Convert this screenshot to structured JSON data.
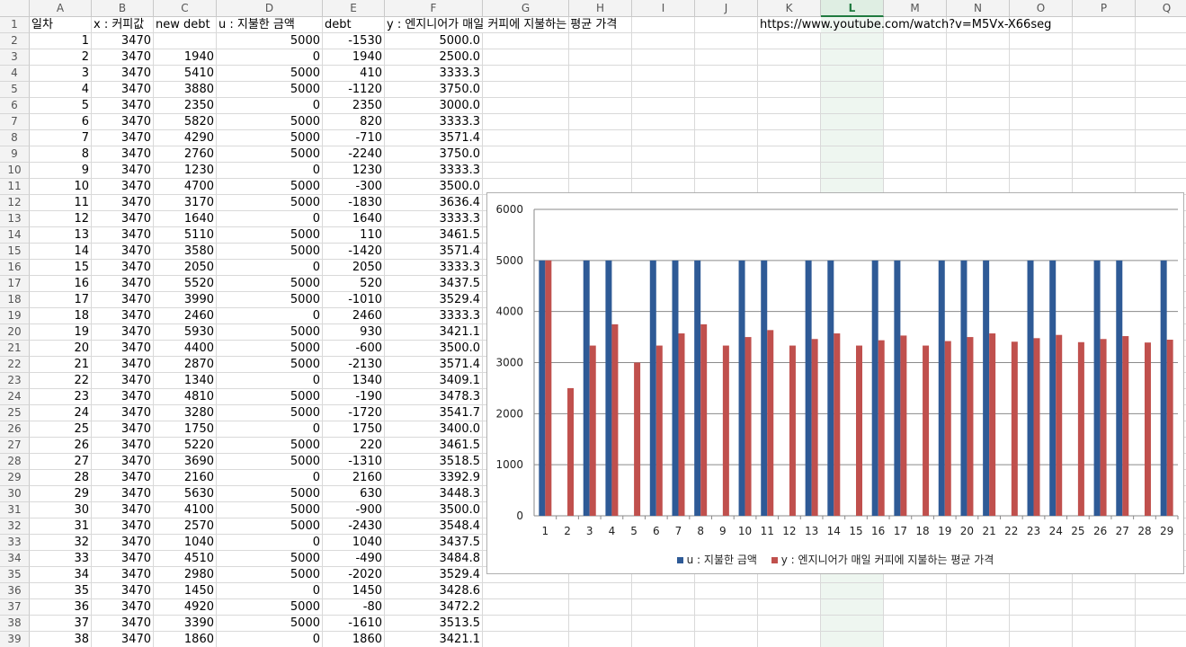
{
  "columns": [
    "A",
    "B",
    "C",
    "D",
    "E",
    "F",
    "G",
    "H",
    "I",
    "J",
    "K",
    "L",
    "M",
    "N",
    "O",
    "P",
    "Q"
  ],
  "selected_column": "L",
  "header_row": {
    "A": "일차",
    "B": "x : 커피값",
    "C": "new debt",
    "D": "u : 지불한 금액",
    "E": "debt",
    "F": "y : 엔지니어가 매일 커피에 지불하는 평균 가격",
    "K": "https://www.youtube.com/watch?v=M5Vx-X66seg"
  },
  "rows": [
    [
      "1",
      "3470",
      "",
      "5000",
      "-1530",
      "5000.0"
    ],
    [
      "2",
      "3470",
      "1940",
      "0",
      "1940",
      "2500.0"
    ],
    [
      "3",
      "3470",
      "5410",
      "5000",
      "410",
      "3333.3"
    ],
    [
      "4",
      "3470",
      "3880",
      "5000",
      "-1120",
      "3750.0"
    ],
    [
      "5",
      "3470",
      "2350",
      "0",
      "2350",
      "3000.0"
    ],
    [
      "6",
      "3470",
      "5820",
      "5000",
      "820",
      "3333.3"
    ],
    [
      "7",
      "3470",
      "4290",
      "5000",
      "-710",
      "3571.4"
    ],
    [
      "8",
      "3470",
      "2760",
      "5000",
      "-2240",
      "3750.0"
    ],
    [
      "9",
      "3470",
      "1230",
      "0",
      "1230",
      "3333.3"
    ],
    [
      "10",
      "3470",
      "4700",
      "5000",
      "-300",
      "3500.0"
    ],
    [
      "11",
      "3470",
      "3170",
      "5000",
      "-1830",
      "3636.4"
    ],
    [
      "12",
      "3470",
      "1640",
      "0",
      "1640",
      "3333.3"
    ],
    [
      "13",
      "3470",
      "5110",
      "5000",
      "110",
      "3461.5"
    ],
    [
      "14",
      "3470",
      "3580",
      "5000",
      "-1420",
      "3571.4"
    ],
    [
      "15",
      "3470",
      "2050",
      "0",
      "2050",
      "3333.3"
    ],
    [
      "16",
      "3470",
      "5520",
      "5000",
      "520",
      "3437.5"
    ],
    [
      "17",
      "3470",
      "3990",
      "5000",
      "-1010",
      "3529.4"
    ],
    [
      "18",
      "3470",
      "2460",
      "0",
      "2460",
      "3333.3"
    ],
    [
      "19",
      "3470",
      "5930",
      "5000",
      "930",
      "3421.1"
    ],
    [
      "20",
      "3470",
      "4400",
      "5000",
      "-600",
      "3500.0"
    ],
    [
      "21",
      "3470",
      "2870",
      "5000",
      "-2130",
      "3571.4"
    ],
    [
      "22",
      "3470",
      "1340",
      "0",
      "1340",
      "3409.1"
    ],
    [
      "23",
      "3470",
      "4810",
      "5000",
      "-190",
      "3478.3"
    ],
    [
      "24",
      "3470",
      "3280",
      "5000",
      "-1720",
      "3541.7"
    ],
    [
      "25",
      "3470",
      "1750",
      "0",
      "1750",
      "3400.0"
    ],
    [
      "26",
      "3470",
      "5220",
      "5000",
      "220",
      "3461.5"
    ],
    [
      "27",
      "3470",
      "3690",
      "5000",
      "-1310",
      "3518.5"
    ],
    [
      "28",
      "3470",
      "2160",
      "0",
      "2160",
      "3392.9"
    ],
    [
      "29",
      "3470",
      "5630",
      "5000",
      "630",
      "3448.3"
    ],
    [
      "30",
      "3470",
      "4100",
      "5000",
      "-900",
      "3500.0"
    ],
    [
      "31",
      "3470",
      "2570",
      "5000",
      "-2430",
      "3548.4"
    ],
    [
      "32",
      "3470",
      "1040",
      "0",
      "1040",
      "3437.5"
    ],
    [
      "33",
      "3470",
      "4510",
      "5000",
      "-490",
      "3484.8"
    ],
    [
      "34",
      "3470",
      "2980",
      "5000",
      "-2020",
      "3529.4"
    ],
    [
      "35",
      "3470",
      "1450",
      "0",
      "1450",
      "3428.6"
    ],
    [
      "36",
      "3470",
      "4920",
      "5000",
      "-80",
      "3472.2"
    ],
    [
      "37",
      "3470",
      "3390",
      "5000",
      "-1610",
      "3513.5"
    ],
    [
      "38",
      "3470",
      "1860",
      "0",
      "1860",
      "3421.1"
    ]
  ],
  "colors": {
    "series_u": "#2e5a96",
    "series_y": "#c0504d",
    "selected_header": "#1f7a3f"
  },
  "chart_data": {
    "type": "bar",
    "categories": [
      "1",
      "2",
      "3",
      "4",
      "5",
      "6",
      "7",
      "8",
      "9",
      "10",
      "11",
      "12",
      "13",
      "14",
      "15",
      "16",
      "17",
      "18",
      "19",
      "20",
      "21",
      "22",
      "23",
      "24",
      "25",
      "26",
      "27",
      "28",
      "29"
    ],
    "series": [
      {
        "name": "u : 지불한 금액",
        "values": [
          5000,
          0,
          5000,
          5000,
          0,
          5000,
          5000,
          5000,
          0,
          5000,
          5000,
          0,
          5000,
          5000,
          0,
          5000,
          5000,
          0,
          5000,
          5000,
          5000,
          0,
          5000,
          5000,
          0,
          5000,
          5000,
          0,
          5000
        ]
      },
      {
        "name": "y : 엔지니어가 매일 커피에 지불하는 평균 가격",
        "values": [
          5000.0,
          2500.0,
          3333.3,
          3750.0,
          3000.0,
          3333.3,
          3571.4,
          3750.0,
          3333.3,
          3500.0,
          3636.4,
          3333.3,
          3461.5,
          3571.4,
          3333.3,
          3437.5,
          3529.4,
          3333.3,
          3421.1,
          3500.0,
          3571.4,
          3409.1,
          3478.3,
          3541.7,
          3400.0,
          3461.5,
          3518.5,
          3392.9,
          3448.3
        ]
      }
    ],
    "yticks": [
      "0",
      "1000",
      "2000",
      "3000",
      "4000",
      "5000",
      "6000"
    ],
    "ylim": [
      0,
      6000
    ],
    "grid": true,
    "legend": "bottom"
  }
}
